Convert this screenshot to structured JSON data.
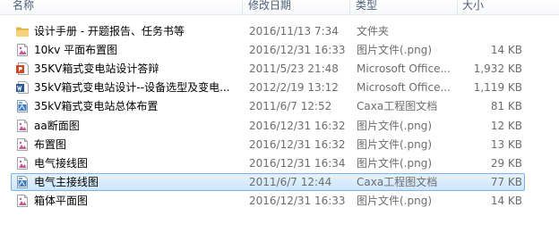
{
  "columns": {
    "name": "名称",
    "date": "修改日期",
    "type": "类型",
    "size": "大小"
  },
  "files": [
    {
      "name": "设计手册 - 开题报告、任务书等",
      "date": "2016/11/13 7:34",
      "type": "文件夹",
      "size": "",
      "icon": "folder-icon"
    },
    {
      "name": "10kv 平面布置图",
      "date": "2016/12/31 16:33",
      "type": "图片文件(.png)",
      "size": "14 KB",
      "icon": "png-image-icon"
    },
    {
      "name": "35KV箱式变电站设计答辩",
      "date": "2011/5/23 21:48",
      "type": "Microsoft Office...",
      "size": "1,932 KB",
      "icon": "powerpoint-icon"
    },
    {
      "name": "35kV箱式变电站设计--设备选型及变电...",
      "date": "2012/2/19 13:12",
      "type": "Microsoft Office...",
      "size": "1,119 KB",
      "icon": "word-icon"
    },
    {
      "name": "35kV箱式变电站总体布置",
      "date": "2011/6/7 12:52",
      "type": "Caxa工程图文档",
      "size": "81 KB",
      "icon": "caxa-icon"
    },
    {
      "name": "aa断面图",
      "date": "2016/12/31 16:32",
      "type": "图片文件(.png)",
      "size": "12 KB",
      "icon": "png-image-icon"
    },
    {
      "name": "布置图",
      "date": "2016/12/31 16:32",
      "type": "图片文件(.png)",
      "size": "13 KB",
      "icon": "png-image-icon"
    },
    {
      "name": "电气接线图",
      "date": "2016/12/31 16:34",
      "type": "图片文件(.png)",
      "size": "29 KB",
      "icon": "png-image-icon"
    },
    {
      "name": "电气主接线图",
      "date": "2011/6/7 12:44",
      "type": "Caxa工程图文档",
      "size": "77 KB",
      "icon": "caxa-icon",
      "selected": true
    },
    {
      "name": "箱体平面图",
      "date": "2016/12/31 16:33",
      "type": "图片文件(.png)",
      "size": "14 KB",
      "icon": "png-image-icon"
    }
  ],
  "colors": {
    "selection_fill": "#cde6fb",
    "selection_border": "#7bb3e7",
    "header_text": "#4c607a",
    "secondary_text": "#6d6d6d"
  }
}
